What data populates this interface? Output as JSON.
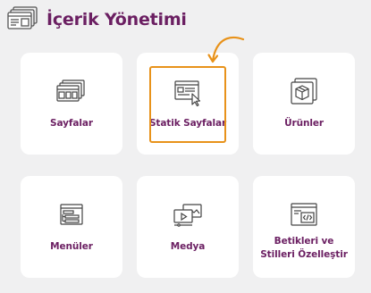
{
  "header": {
    "title": "İçerik Yönetimi",
    "icon": "content-management-icon"
  },
  "accent_color": "#6b1f62",
  "highlight_color": "#e8921a",
  "cards": [
    {
      "label": "Sayfalar",
      "icon": "pages-icon"
    },
    {
      "label": "Statik Sayfalar",
      "icon": "static-pages-icon",
      "highlighted": true
    },
    {
      "label": "Ürünler",
      "icon": "products-icon"
    },
    {
      "label": "Menüler",
      "icon": "menus-icon"
    },
    {
      "label": "Medya",
      "icon": "media-icon"
    },
    {
      "label": "Betikleri ve Stilleri Özelleştir",
      "icon": "customize-scripts-styles-icon"
    }
  ]
}
